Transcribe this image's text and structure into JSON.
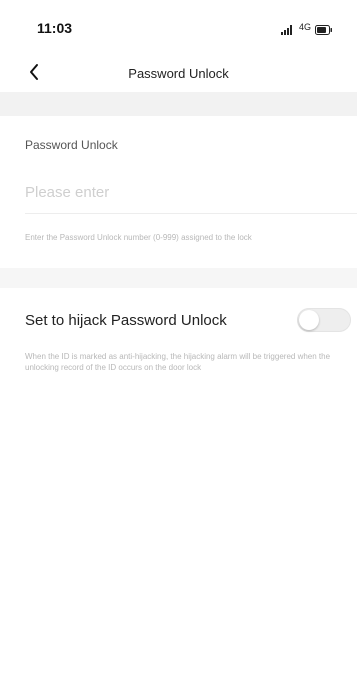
{
  "status_bar": {
    "time": "11:03",
    "network": "4G",
    "signal_icon": "signal-bars-icon",
    "battery_icon": "battery-icon"
  },
  "nav": {
    "back_icon": "chevron-left-icon",
    "title": "Password Unlock"
  },
  "form": {
    "field_label": "Password Unlock",
    "input_value": "",
    "input_placeholder": "Please enter",
    "hint": "Enter the Password Unlock number (0-999) assigned to the lock"
  },
  "hijack": {
    "label": "Set to hijack Password Unlock",
    "enabled": false,
    "hint": "When the ID is marked as anti-hijacking, the hijacking alarm will be triggered when the unlocking record of the ID occurs on the door lock"
  },
  "colors": {
    "background": "#f4f4f4",
    "surface": "#ffffff",
    "placeholder": "#cfcfcf",
    "hint_text": "#b8b8b8",
    "toggle_off": "#eeeeee"
  }
}
